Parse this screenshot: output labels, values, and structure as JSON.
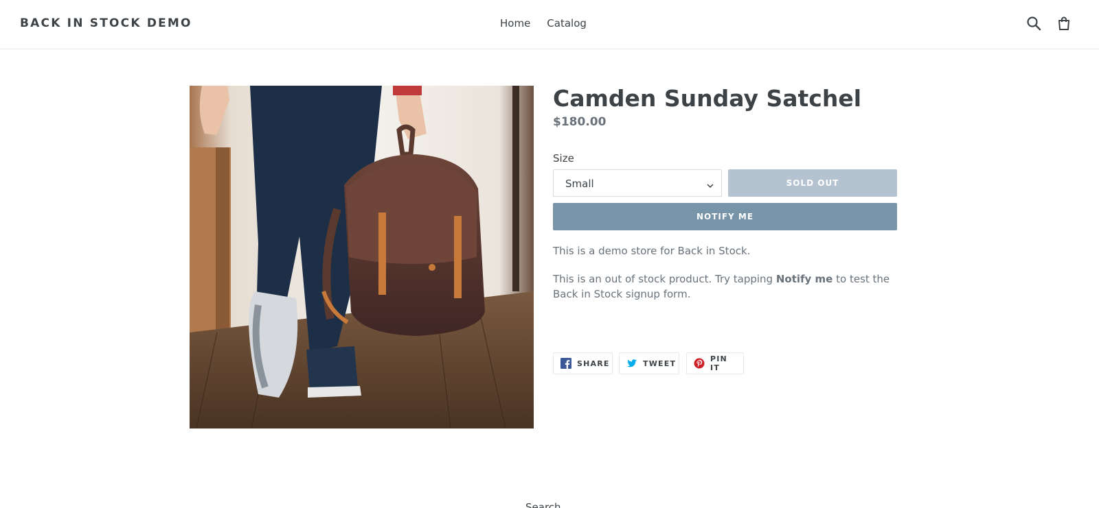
{
  "header": {
    "logo": "BACK IN STOCK DEMO",
    "nav": [
      {
        "label": "Home"
      },
      {
        "label": "Catalog"
      }
    ],
    "icons": [
      "search-icon",
      "cart-icon"
    ]
  },
  "product": {
    "title": "Camden Sunday Satchel",
    "price": "$180.00",
    "size_label": "Size",
    "size_selected": "Small",
    "sold_out_label": "SOLD OUT",
    "notify_label": "NOTIFY ME",
    "description_1": "This is a demo store for Back in Stock.",
    "description_2_pre": "This is an out of stock product. Try tapping ",
    "description_2_bold": "Notify me",
    "description_2_post": " to test the Back in Stock signup form."
  },
  "share": {
    "facebook": "SHARE",
    "twitter": "TWEET",
    "pinterest": "PIN IT"
  },
  "footer": {
    "peek_text": "Search"
  },
  "colors": {
    "notify_button": "#7794a8",
    "sold_out_button": "#b4c3cf",
    "text": "#3d4246",
    "muted_text": "#69727b",
    "facebook": "#3b5998",
    "twitter": "#00aced",
    "pinterest": "#cb2027"
  }
}
